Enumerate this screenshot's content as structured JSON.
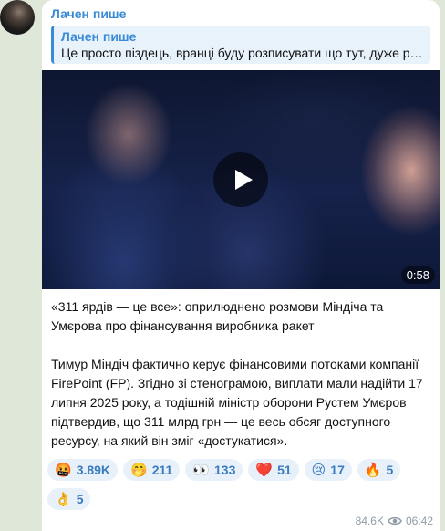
{
  "sender": {
    "name": "Лачен пише"
  },
  "reply": {
    "author": "Лачен пише",
    "text": "Це просто піздець, вранці буду розписувати що тут, дуже ре…"
  },
  "video": {
    "duration": "0:58"
  },
  "message": {
    "headline": "«311 ярдів — це все»: оприлюднено розмови Міндіча та Умєрова про фінансування виробника ракет",
    "body": "Тимур Міндіч фактично керує фінансовими потоками компанії FirePoint (FP). Згідно зі стенограмою, виплати мали надійти 17 липня 2025 року, а тодішній міністр оборони Рустем Умєров підтвердив, що 311 млрд грн — це весь обсяг доступного ресурсу, на який він зміг «достукатися»."
  },
  "reactions": [
    {
      "emoji": "🤬",
      "icon": "angry-face-icon",
      "count": "3.89K"
    },
    {
      "emoji": "🤭",
      "icon": "hand-over-mouth-icon",
      "count": "211"
    },
    {
      "emoji": "👀",
      "icon": "eyes-icon",
      "count": "133"
    },
    {
      "emoji": "❤️",
      "icon": "heart-icon",
      "count": "51"
    },
    {
      "emoji": "😢",
      "icon": "crying-face-icon",
      "count": "17"
    },
    {
      "emoji": "🔥",
      "icon": "fire-icon",
      "count": "5"
    },
    {
      "emoji": "👌",
      "icon": "ok-hand-icon",
      "count": "5"
    }
  ],
  "meta": {
    "views": "84.6K",
    "time": "06:42"
  },
  "colors": {
    "accent": "#3a8bd6",
    "background": "#dfe7d9",
    "reaction_bg": "#e8f1fa"
  }
}
